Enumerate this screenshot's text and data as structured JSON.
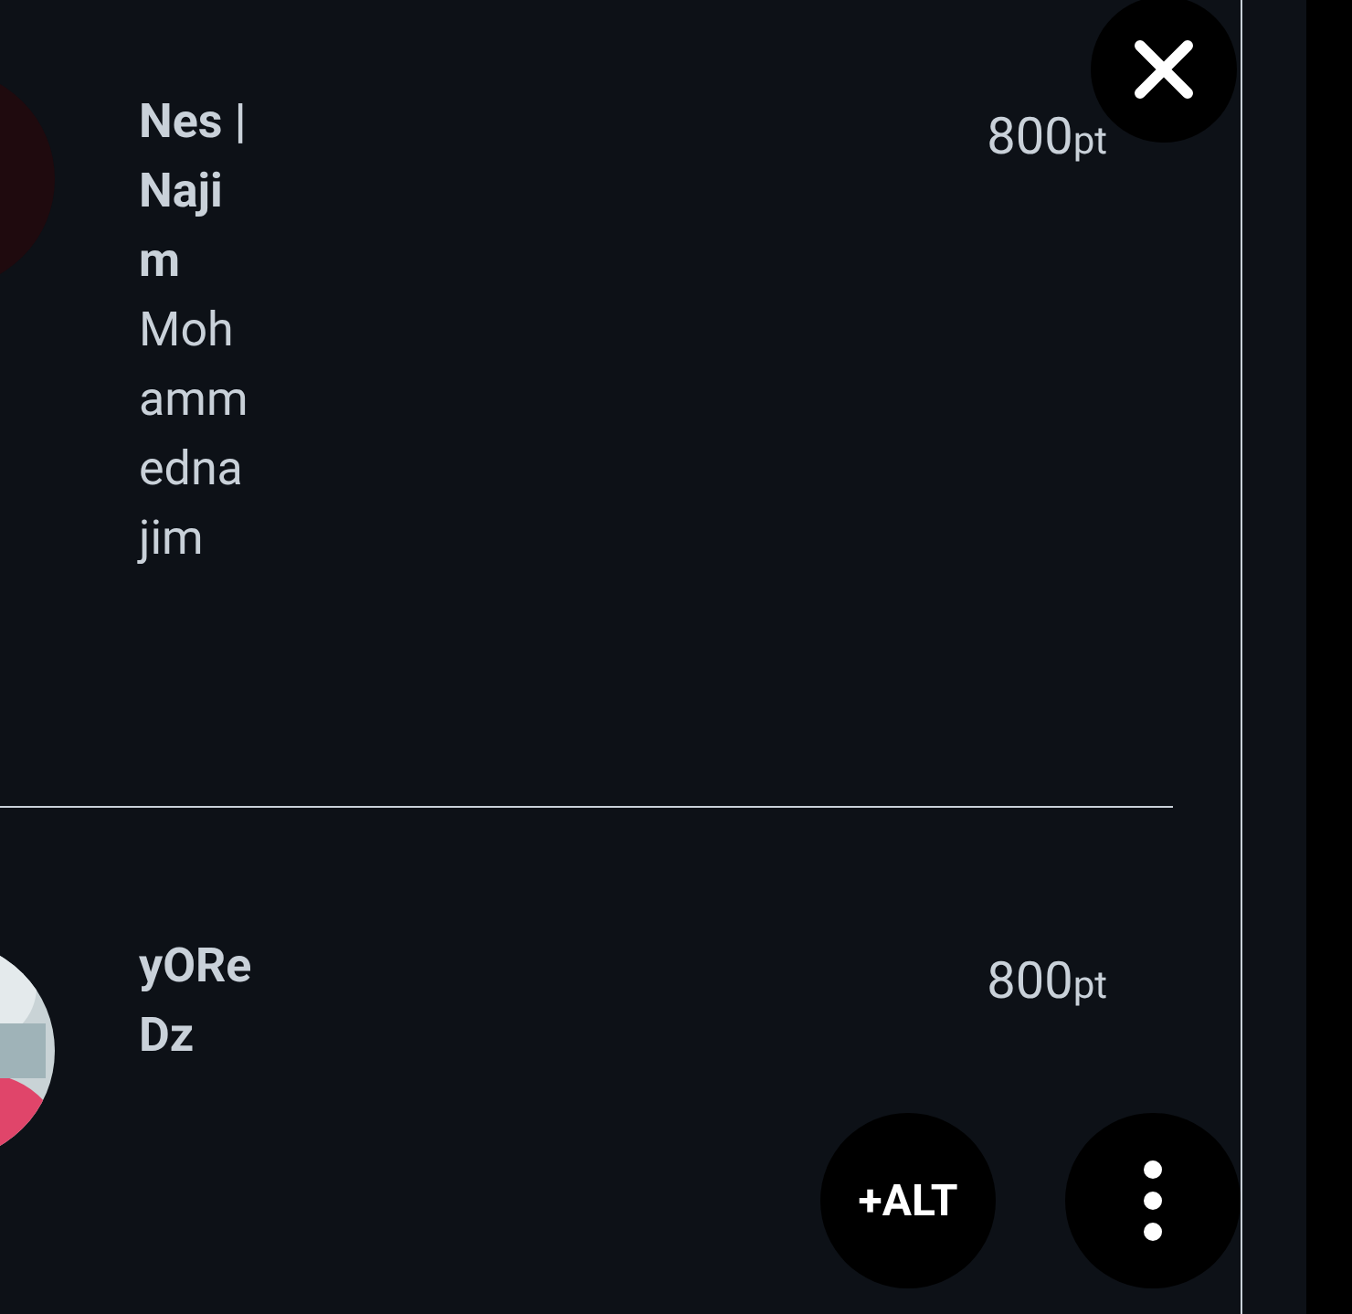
{
  "entries": [
    {
      "name": "Nes | Najim",
      "handle": "Mohammednajim",
      "points": "800",
      "unit": "pt",
      "kind": "dark"
    },
    {
      "name": "yOReDz",
      "points": "800",
      "unit": "pt",
      "kind": "picture"
    }
  ],
  "buttons": [
    {
      "kind": "alt",
      "label": "+ALT"
    },
    {
      "kind": "more"
    }
  ]
}
